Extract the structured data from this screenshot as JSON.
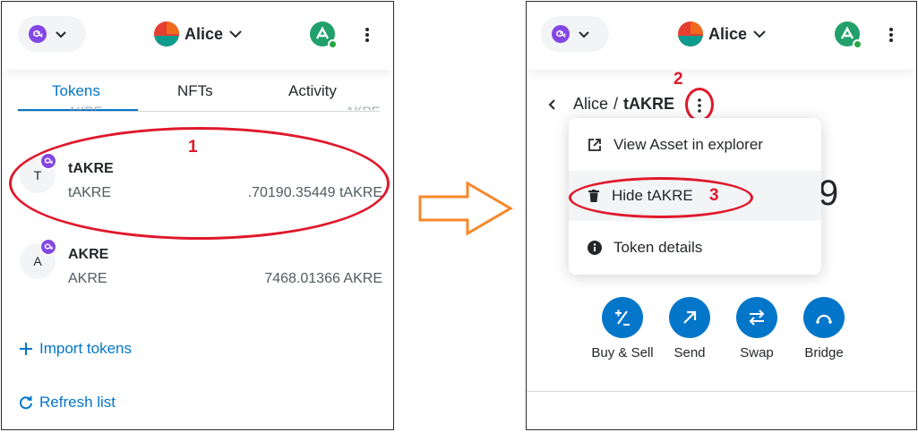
{
  "left": {
    "header": {
      "account_name": "Alice"
    },
    "tabs": [
      {
        "label": "Tokens",
        "active": true
      },
      {
        "label": "NFTs",
        "active": false
      },
      {
        "label": "Activity",
        "active": false
      }
    ],
    "clipped_row": {
      "sub": "AKRE",
      "amount": "AKRE"
    },
    "tokens": [
      {
        "avatar_letter": "T",
        "name": "tAKRE",
        "symbol": "tAKRE",
        "amount": ".70190.35449 tAKRE"
      },
      {
        "avatar_letter": "A",
        "name": "AKRE",
        "symbol": "AKRE",
        "amount": "7468.01366 AKRE"
      }
    ],
    "import_tokens_label": "Import tokens",
    "refresh_list_label": "Refresh list",
    "annotation": "1"
  },
  "right": {
    "header": {
      "account_name": "Alice"
    },
    "breadcrumb": {
      "account": "Alice",
      "separator": "/",
      "token": "tAKRE"
    },
    "annotation_kebab": "2",
    "menu": {
      "items": [
        {
          "label": "View Asset in explorer",
          "icon": "external-link-icon"
        },
        {
          "label": "Hide tAKRE",
          "icon": "trash-icon"
        },
        {
          "label": "Token details",
          "icon": "info-icon"
        }
      ]
    },
    "annotation_hide": "3",
    "obscured_balance_digit": "9",
    "actions": [
      {
        "label": "Buy & Sell",
        "icon": "plus-minus-icon"
      },
      {
        "label": "Send",
        "icon": "arrow-up-right-icon"
      },
      {
        "label": "Swap",
        "icon": "swap-arrows-icon"
      },
      {
        "label": "Bridge",
        "icon": "bridge-icon"
      }
    ]
  },
  "colors": {
    "accent": "#0376c9",
    "annotation": "#e0182b",
    "arrow": "#f5882a",
    "network_badge": "#8247e5"
  }
}
